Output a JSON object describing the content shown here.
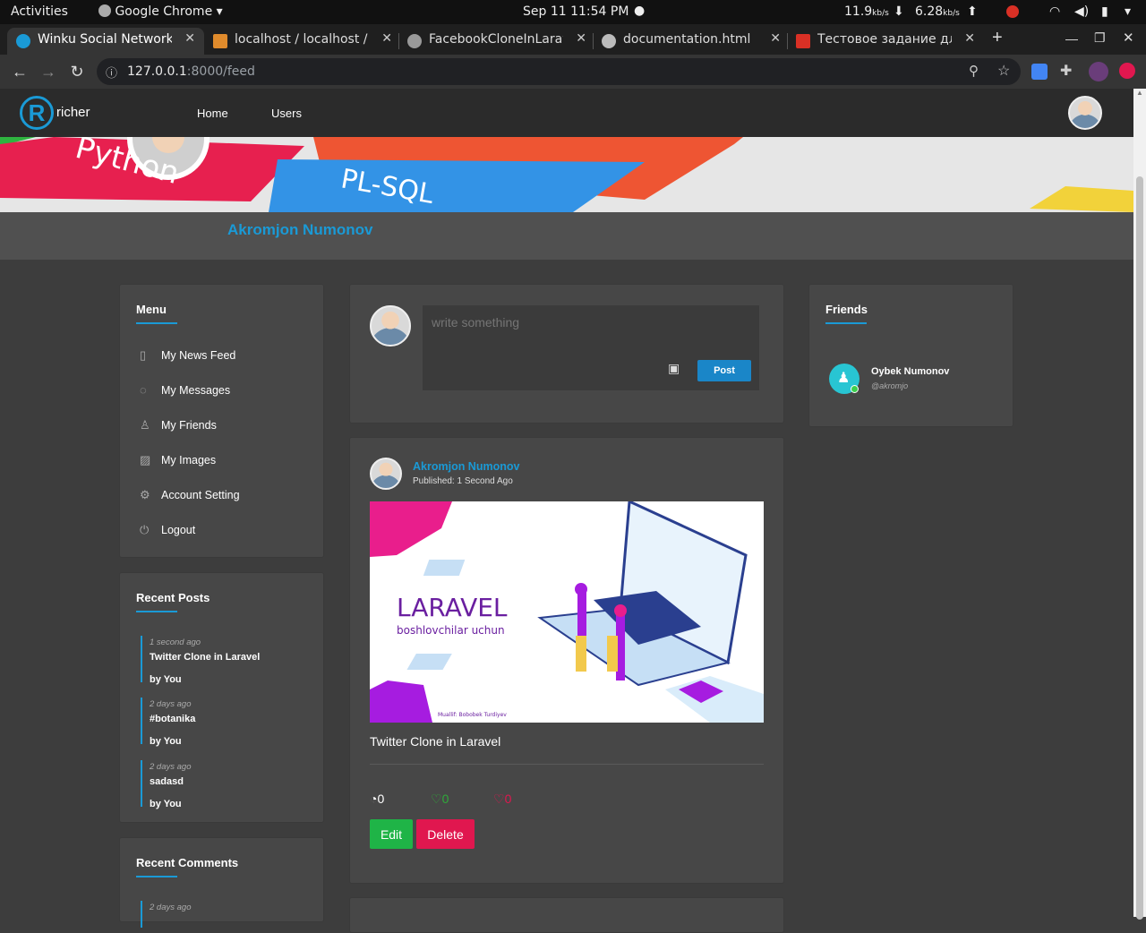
{
  "os": {
    "activities": "Activities",
    "app": "Google Chrome",
    "datetime": "Sep 11  11:54 PM",
    "net_down": "11.9",
    "net_down_unit": "kb/s",
    "net_up": "6.28",
    "net_up_unit": "kb/s"
  },
  "tabs": [
    {
      "title": "Winku Social Network",
      "icon_color": "#1a9ad6"
    },
    {
      "title": "localhost / localhost / ",
      "icon_color": "#e08b2c"
    },
    {
      "title": "FacebookCloneInLarav",
      "icon_color": "#999999"
    },
    {
      "title": "documentation.html",
      "icon_color": "#bbbbbb"
    },
    {
      "title": "Тестовое задание для",
      "icon_color": "#d93025"
    }
  ],
  "browser": {
    "url_host": "127.0.0.1",
    "url_path": ":8000/feed"
  },
  "header": {
    "logo_letter": "R",
    "logo_text": "richer",
    "nav": [
      "Home",
      "Users"
    ]
  },
  "profile": {
    "name": "Akromjon Numonov"
  },
  "menu": {
    "title": "Menu",
    "items": [
      {
        "label": "My News Feed",
        "icon": "clipboard-icon"
      },
      {
        "label": "My Messages",
        "icon": "chat-icon"
      },
      {
        "label": "My Friends",
        "icon": "user-icon"
      },
      {
        "label": "My Images",
        "icon": "image-icon"
      },
      {
        "label": "Account Setting",
        "icon": "gear-icon"
      },
      {
        "label": "Logout",
        "icon": "power-icon"
      }
    ]
  },
  "recent_posts": {
    "title": "Recent Posts",
    "items": [
      {
        "time": "1 second ago",
        "title": "Twitter Clone in Laravel",
        "by": "by You"
      },
      {
        "time": "2 days ago",
        "title": "#botanika",
        "by": "by You"
      },
      {
        "time": "2 days ago",
        "title": "sadasd",
        "by": "by You"
      }
    ]
  },
  "recent_comments": {
    "title": "Recent Comments",
    "items": [
      {
        "time": "2 days ago"
      }
    ]
  },
  "composer": {
    "placeholder": "write something",
    "post_button": "Post"
  },
  "post": {
    "author": "Akromjon Numonov",
    "published": "Published: 1 Second Ago",
    "image_title": "LARAVEL",
    "image_subtitle": "boshlovchilar uchun",
    "image_credit": "Muallif: Bobobek Turdiyev",
    "text": "Twitter Clone in Laravel",
    "comments": "0",
    "likes": "0",
    "dislikes": "0",
    "edit_button": "Edit",
    "delete_button": "Delete"
  },
  "friends": {
    "title": "Friends",
    "items": [
      {
        "name": "Oybek Numonov",
        "handle": "@akromjo",
        "online": true
      }
    ]
  },
  "colors": {
    "accent": "#1a9ad6",
    "edit": "#1fb447",
    "delete": "#e0174f",
    "like": "#2faa3a",
    "dislike": "#e0174f"
  }
}
